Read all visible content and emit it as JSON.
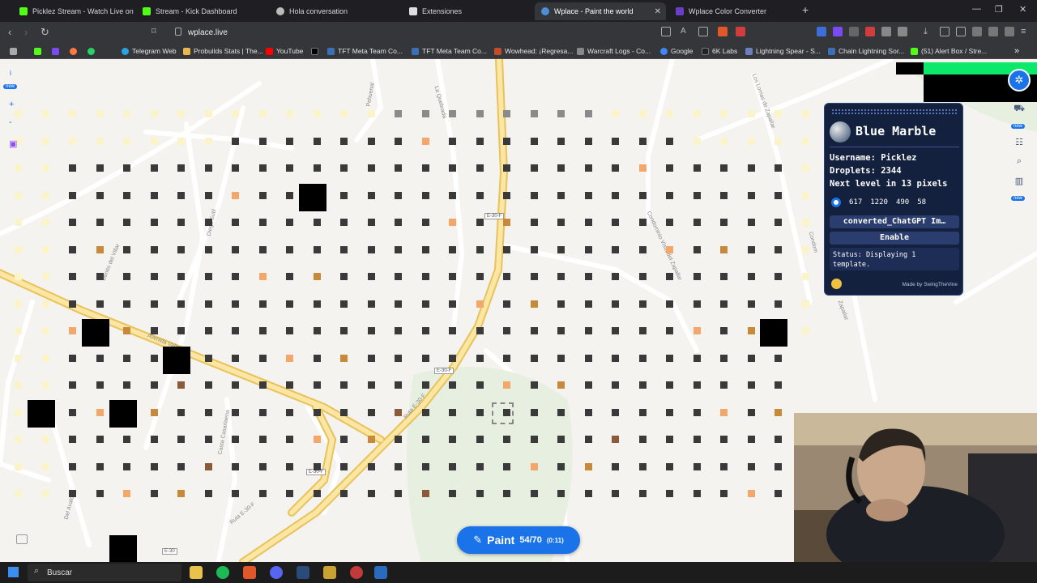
{
  "browser": {
    "tabs": [
      {
        "label": "Picklez Stream - Watch Live on Kick",
        "color": "#53fc18"
      },
      {
        "label": "Stream - Kick Dashboard",
        "color": "#53fc18"
      },
      {
        "label": "Hola conversation",
        "color": "#bbbbbb"
      },
      {
        "label": "Extensiones",
        "color": "#dddddd"
      },
      {
        "label": "Wplace - Paint the world",
        "color": "#4d8fd6",
        "close": "✕"
      },
      {
        "label": "Wplace Color Converter",
        "color": "#6a3fc8"
      }
    ],
    "new_tab": "+",
    "url": "wplace.live",
    "bookmarks": [
      {
        "label": "",
        "color": "#53fc18"
      },
      {
        "label": "",
        "color": "#7a4cf0"
      },
      {
        "label": "",
        "color": "#ff7a3c"
      },
      {
        "label": "",
        "color": "#25d366"
      },
      {
        "label": "Telegram Web",
        "color": "#2aa3e0"
      },
      {
        "label": "Probuilds Stats | The...",
        "color": "#e8b84a"
      },
      {
        "label": "YouTube",
        "color": "#ff0000"
      },
      {
        "label": "",
        "color": "#000000"
      },
      {
        "label": "TFT Meta Team Co...",
        "color": "#3b6fb6"
      },
      {
        "label": "TFT Meta Team Co...",
        "color": "#3b6fb6"
      },
      {
        "label": "Wowhead: ¡Regresa...",
        "color": "#c44a2a"
      },
      {
        "label": "Warcraft Logs - Co...",
        "color": "#888888"
      },
      {
        "label": "Google",
        "color": "#4285f4"
      },
      {
        "label": "6K Labs",
        "color": "#222222"
      },
      {
        "label": "Lightning Spear - S...",
        "color": "#6b7dbb"
      },
      {
        "label": "Chain Lightning Sor...",
        "color": "#3b6fb6"
      },
      {
        "label": "(51) Alert Box / Stre...",
        "color": "#53fc18"
      }
    ]
  },
  "left_rail": {
    "new": "new",
    "zoom_in": "+",
    "zoom_out": "-"
  },
  "right_rail": {
    "new1": "new",
    "new2": "new"
  },
  "blue_marble": {
    "title": "Blue Marble",
    "username_label": "Username:",
    "username": "Picklez",
    "droplets_label": "Droplets:",
    "droplets": "2344",
    "next_level_prefix": "Next level in",
    "next_level_pixels": "13",
    "next_level_suffix": "pixels",
    "coords": [
      "617",
      "1220",
      "490",
      "58"
    ],
    "template_name": "converted_ChatGPT Im…",
    "enable": "Enable",
    "status": "Status: Displaying 1 template.",
    "made_by": "Made by SwingTheVine"
  },
  "paint": {
    "label": "Paint",
    "count": "54/70",
    "timer": "(0:11)"
  },
  "streets": [
    {
      "text": "Pehuenal"
    },
    {
      "text": "La Quebrada"
    },
    {
      "text": "Diego Sutil"
    },
    {
      "text": "Benito del Villar"
    },
    {
      "text": "Avenida Valle"
    },
    {
      "text": "Condominio Vista del Zapallar"
    },
    {
      "text": "Los Lomas de Zapallar"
    },
    {
      "text": "Ruta E-30-F"
    },
    {
      "text": "Ruta E-30-F"
    },
    {
      "text": "Del Avalde"
    },
    {
      "text": "Casta Casarlaena"
    },
    {
      "text": "Condom"
    },
    {
      "text": "Zapallar"
    }
  ],
  "road_tags": [
    "E-30-F",
    "E-30-F",
    "E-30-F",
    "E-30"
  ],
  "taskbar": {
    "search": "Buscar"
  },
  "colors": {
    "accent": "#1a73e8",
    "panel": "#14213e",
    "dark_pixel": "#3a3a3a"
  }
}
